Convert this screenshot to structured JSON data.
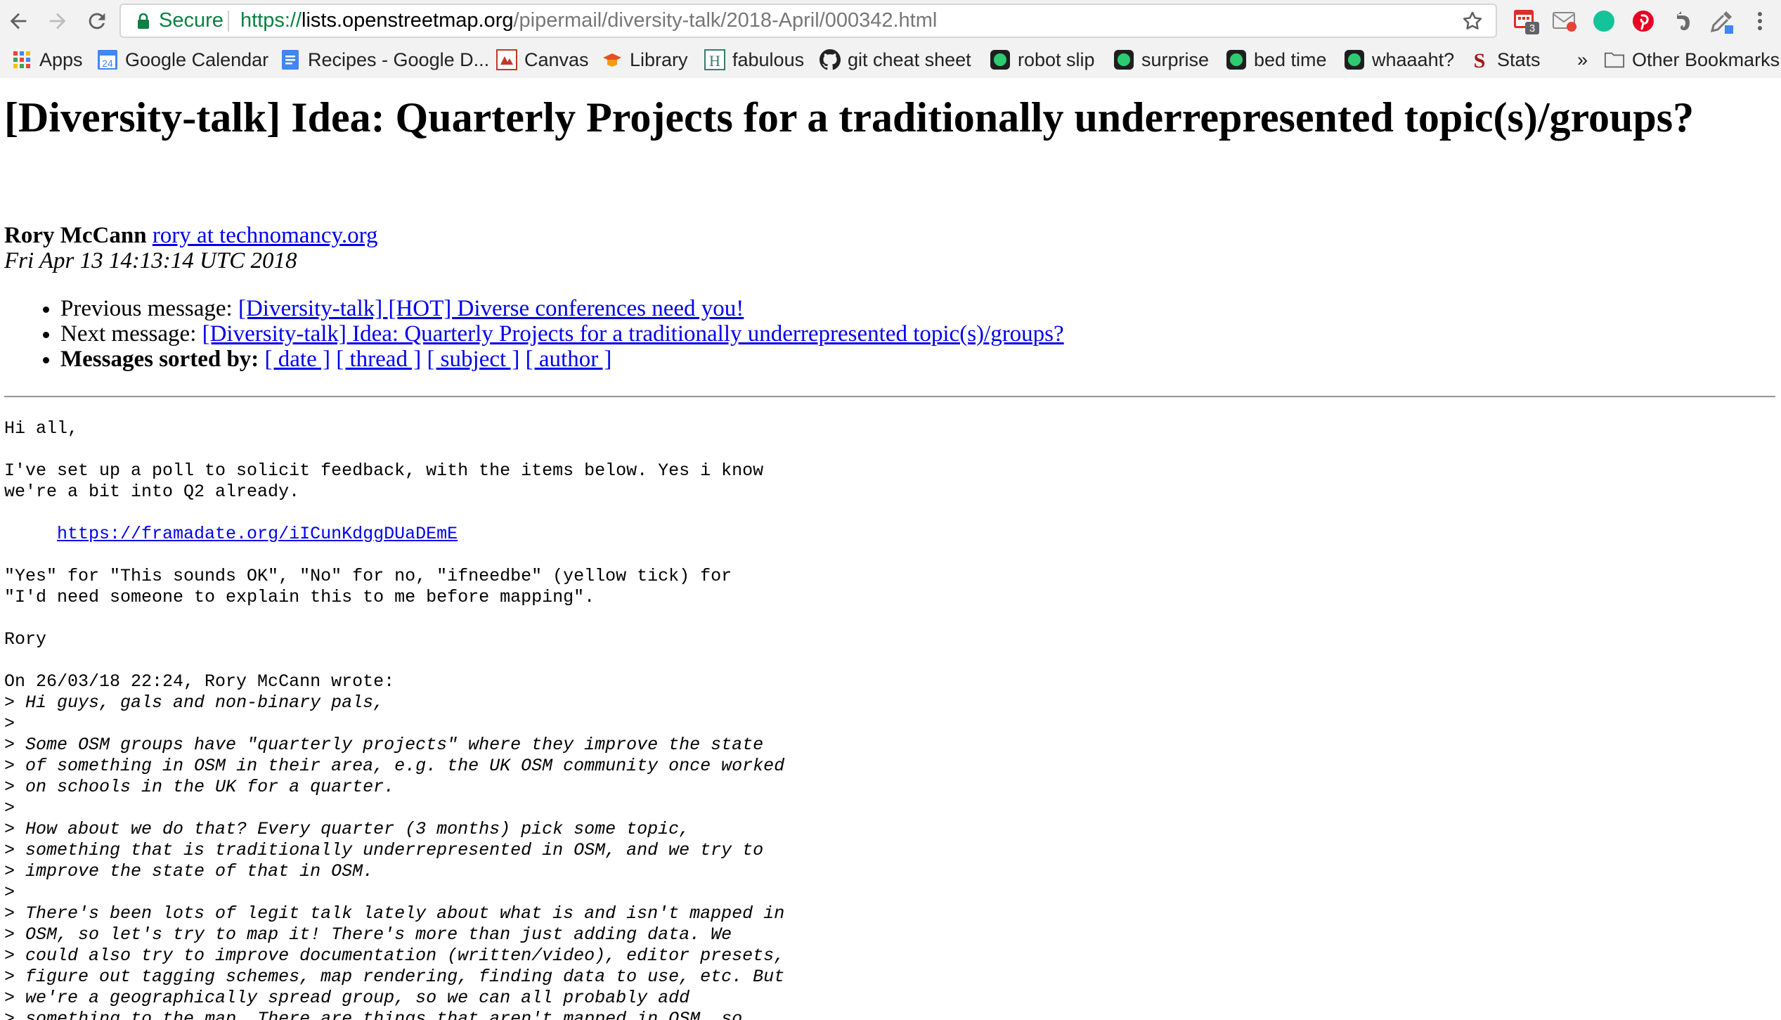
{
  "browser": {
    "secure_label": "Secure",
    "url_scheme": "https://",
    "url_host": "lists.openstreetmap.org",
    "url_path": "/pipermail/diversity-talk/2018-April/000342.html",
    "extension_badge": "3",
    "bookmarks": [
      {
        "label": "Apps",
        "icon": "apps-grid-icon"
      },
      {
        "label": "Google Calendar",
        "icon": "calendar-icon",
        "icon_text": "24"
      },
      {
        "label": "Recipes - Google D...",
        "icon": "docs-icon"
      },
      {
        "label": "Canvas",
        "icon": "canvas-icon"
      },
      {
        "label": "Library",
        "icon": "library-icon"
      },
      {
        "label": "fabulous",
        "icon": "fabulous-icon",
        "icon_text": "H"
      },
      {
        "label": "git cheat sheet",
        "icon": "github-icon"
      },
      {
        "label": "robot slip",
        "icon": "green-dot-icon"
      },
      {
        "label": "surprise",
        "icon": "green-dot-icon"
      },
      {
        "label": "bed time",
        "icon": "green-dot-icon"
      },
      {
        "label": "whaaaht?",
        "icon": "green-dot-icon"
      },
      {
        "label": "Stats",
        "icon": "stats-icon",
        "icon_text": "S"
      }
    ],
    "overflow_label": "»",
    "other_bookmarks": "Other Bookmarks"
  },
  "message": {
    "title": "[Diversity-talk] Idea: Quarterly Projects for a traditionally underrepresented topic(s)/groups?",
    "author_name": "Rory McCann",
    "author_email": "rory at technomancy.org ",
    "date": "Fri Apr 13 14:13:14 UTC 2018",
    "prev_label": "Previous message: ",
    "prev_link": "[Diversity-talk] [HOT] Diverse conferences need you!",
    "next_label": "Next message: ",
    "next_link": "[Diversity-talk] Idea: Quarterly Projects for a traditionally underrepresented topic(s)/groups?",
    "sorted_label": "Messages sorted by:",
    "sort_links": [
      "[ date ]",
      "[ thread ]",
      "[ subject ]",
      "[ author ]"
    ],
    "body_greeting": "Hi all,",
    "body_p1": "I've set up a poll to solicit feedback, with the items below. Yes i know\nwe're a bit into Q2 already.",
    "body_indent": "     ",
    "poll_url": "https://framadate.org/iICunKdggDUaDEmE",
    "body_p2": "\"Yes\" for \"This sounds OK\", \"No\" for no, \"ifneedbe\" (yellow tick) for\n\"I'd need someone to explain this to me before mapping\".",
    "signature": "Rory",
    "quote_header": "On 26/03/18 22:24, Rory McCann wrote:",
    "quoted_lines": [
      "Hi guys, gals and non-binary pals,",
      "",
      "Some OSM groups have \"quarterly projects\" where they improve the state",
      "of something in OSM in their area, e.g. the UK OSM community once worked",
      "on schools in the UK for a quarter.",
      "",
      "How about we do that? Every quarter (3 months) pick some topic,",
      "something that is traditionally underrepresented in OSM, and we try to",
      "improve the state of that in OSM.",
      "",
      "There's been lots of legit talk lately about what is and isn't mapped in",
      "OSM, so let's try to map it! There's more than just adding data. We",
      "could also try to improve documentation (written/video), editor presets,",
      "figure out tagging schemes, map rendering, finding data to use, etc. But",
      "we're a geographically spread group, so we can all probably add",
      "something to the map. There are things that aren't mapped in OSM, so"
    ]
  }
}
